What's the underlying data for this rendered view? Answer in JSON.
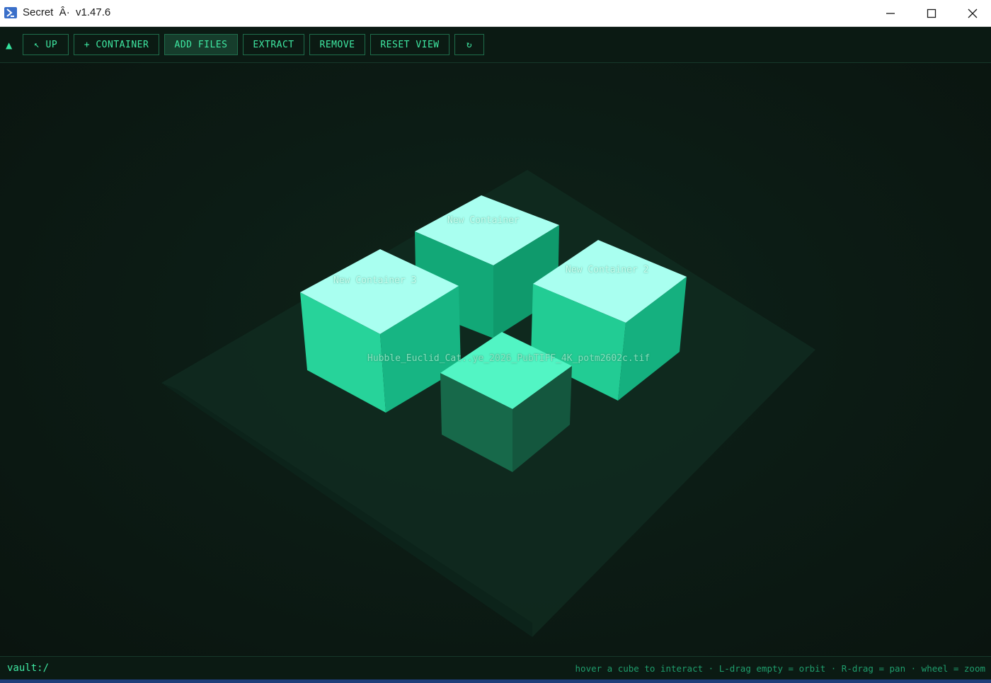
{
  "window": {
    "title": "Secret  Â·  v1.47.6",
    "icons": {
      "app": "powershell-icon",
      "minimize": "minimize-icon",
      "maximize": "maximize-icon",
      "close": "close-icon"
    }
  },
  "toolbar": {
    "collapse_icon": "▲",
    "buttons": {
      "up": "↖ UP",
      "container": "+ CONTAINER",
      "add_files": "ADD FILES",
      "extract": "EXTRACT",
      "remove": "REMOVE",
      "reset_view": "RESET VIEW",
      "refresh": "↻"
    },
    "active_button": "add_files"
  },
  "scene": {
    "containers": [
      {
        "label": "New Container"
      },
      {
        "label": "New Container 3"
      },
      {
        "label": "New Container 2"
      }
    ],
    "files": [
      {
        "label": "Hubble_Euclid_Cat..ye_2026_PubTIFF_4K_potm2602c.tif"
      }
    ],
    "colors": {
      "cube_top": "#a9fff0",
      "cube_side_light": "#27d39a",
      "cube_side_dark": "#0f9a6c",
      "file_top": "#52f5c4",
      "floor": "#0f2f22",
      "accent": "#3fe9a3"
    }
  },
  "statusbar": {
    "path": "vault:/",
    "hint": "hover a cube to interact · L-drag empty = orbit · R-drag = pan · wheel = zoom"
  }
}
